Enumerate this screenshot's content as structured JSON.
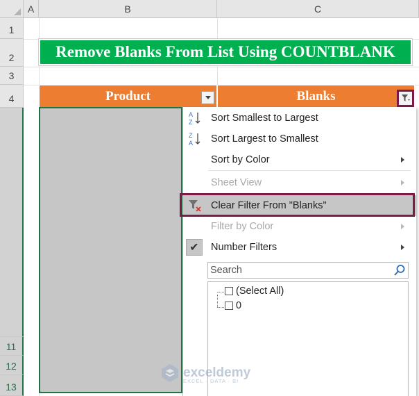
{
  "column_headers": [
    "A",
    "B",
    "C"
  ],
  "row_headers": [
    "1",
    "2",
    "3",
    "4",
    "11",
    "12",
    "13"
  ],
  "title": "Remove Blanks From List Using COUNTBLANK",
  "table_headers": {
    "product": "Product",
    "blanks": "Blanks"
  },
  "menu": {
    "sort_asc": "Sort Smallest to Largest",
    "sort_desc": "Sort Largest to Smallest",
    "sort_color": "Sort by Color",
    "sheet_view": "Sheet View",
    "clear_filter": "Clear Filter From \"Blanks\"",
    "filter_color": "Filter by Color",
    "number_filters": "Number Filters",
    "search_placeholder": "Search",
    "list_items": [
      "(Select All)",
      "0"
    ]
  },
  "watermark": {
    "name": "exceldemy",
    "tagline": "EXCEL · DATA · BI"
  },
  "colors": {
    "title_bg": "#00b050",
    "header_bg": "#ed7d31",
    "highlight_border": "#7b1c48",
    "selection_green": "#217346"
  }
}
